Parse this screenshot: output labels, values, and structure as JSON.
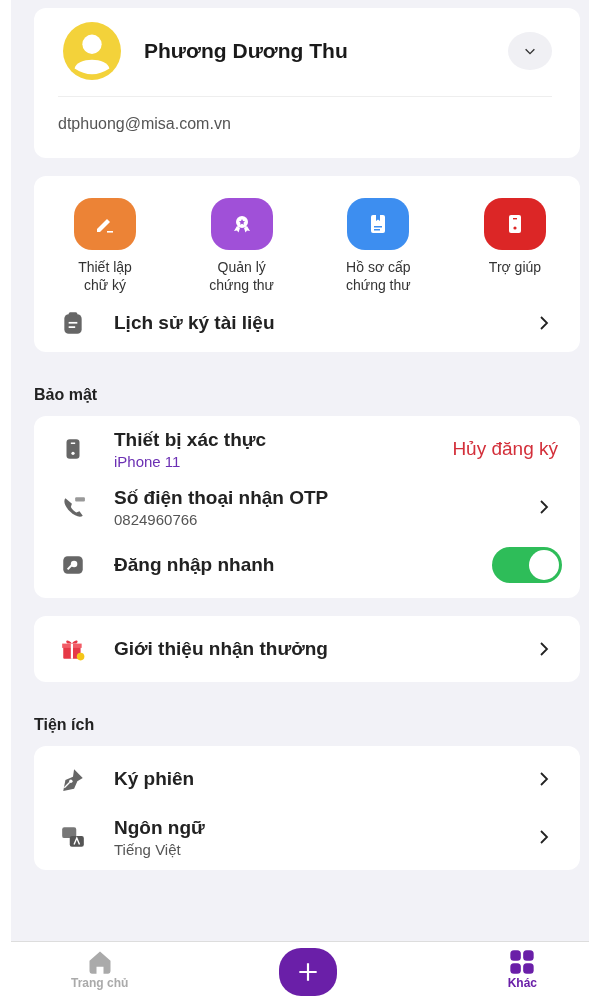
{
  "profile": {
    "name": "Phương Dương Thu",
    "email": "dtphuong@misa.com.vn"
  },
  "quick_actions": [
    {
      "label": "Thiết lập chữ ký",
      "color": "#ec8336"
    },
    {
      "label": "Quản lý chứng thư",
      "color": "#a050d8"
    },
    {
      "label": "Hồ sơ cấp chứng thư",
      "color": "#3d8ef0"
    },
    {
      "label": "Trợ giúp",
      "color": "#dc2626"
    }
  ],
  "history": {
    "label": "Lịch sử ký tài liệu"
  },
  "sections": [
    {
      "title": "Bảo mật",
      "cards": [
        [
          {
            "kind": "action",
            "label": "Thiết bị xác thực",
            "sub": "iPhone 11",
            "action": "Hủy đăng ký"
          },
          {
            "kind": "nav",
            "label": "Số điện thoại nhận OTP",
            "sub": "0824960766"
          },
          {
            "kind": "toggle",
            "label": "Đăng nhập nhanh",
            "on": true
          }
        ],
        [
          {
            "kind": "nav",
            "label": "Giới thiệu nhận thưởng"
          }
        ]
      ]
    },
    {
      "title": "Tiện ích",
      "cards": [
        [
          {
            "kind": "nav",
            "label": "Ký phiên"
          },
          {
            "kind": "nav",
            "label": "Ngôn ngữ",
            "sub": "Tiếng Việt"
          }
        ]
      ]
    }
  ],
  "tabs": [
    {
      "label": "Trang chủ",
      "selected": false
    },
    {
      "label": "Khác",
      "selected": true
    }
  ]
}
